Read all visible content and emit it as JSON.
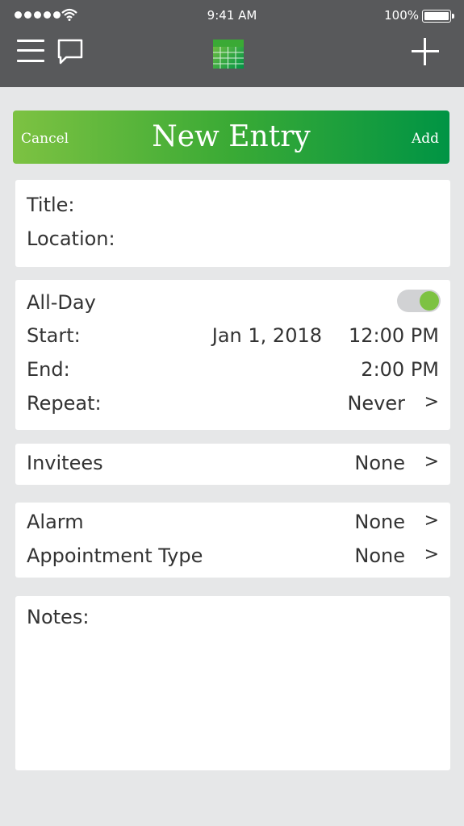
{
  "status_bar": {
    "time": "9:41 AM",
    "battery": "100%"
  },
  "nav": {
    "left_icons": [
      "menu-icon",
      "chat-icon"
    ],
    "center_icon": "calendar-icon",
    "right_icon": "plus-icon"
  },
  "header": {
    "cancel": "Cancel",
    "title": "New Entry",
    "add": "Add"
  },
  "colors": {
    "accent_start": "#7dc242",
    "accent_end": "#009444",
    "topbar": "#58595b"
  },
  "details": {
    "title_label": "Title:",
    "location_label": "Location:"
  },
  "schedule": {
    "all_day_label": "All-Day",
    "all_day_on": true,
    "start_label": "Start:",
    "start_date": "Jan 1, 2018",
    "start_time": "12:00 PM",
    "end_label": "End:",
    "end_time": "2:00 PM",
    "repeat_label": "Repeat:",
    "repeat_value": "Never"
  },
  "invitees": {
    "label": "Invitees",
    "value": "None"
  },
  "alarm": {
    "label": "Alarm",
    "value": "None"
  },
  "appointment_type": {
    "label": "Appointment Type",
    "value": "None"
  },
  "notes": {
    "label": "Notes:"
  },
  "chevron": ">"
}
